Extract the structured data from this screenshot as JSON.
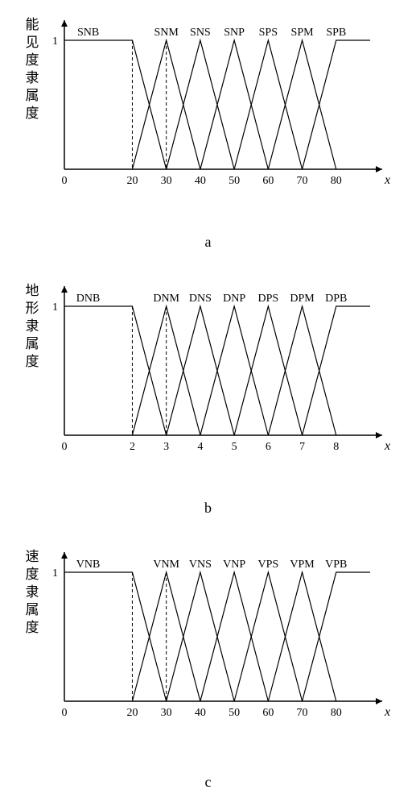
{
  "charts": [
    {
      "id": "a",
      "y_label": "能见度隶属度",
      "sublabel": "a",
      "x_ticks": [
        0,
        20,
        30,
        40,
        50,
        60,
        70,
        80
      ],
      "x_var": "x",
      "y_tick": "1",
      "fuzzy_sets": [
        "SNB",
        "SNM",
        "SNS",
        "SNP",
        "SPS",
        "SPM",
        "SPB"
      ],
      "x_range": [
        0,
        90
      ]
    },
    {
      "id": "b",
      "y_label": "地形隶属度",
      "sublabel": "b",
      "x_ticks": [
        0,
        2,
        3,
        4,
        5,
        6,
        7,
        8
      ],
      "x_var": "x",
      "y_tick": "1",
      "fuzzy_sets": [
        "DNB",
        "DNM",
        "DNS",
        "DNP",
        "DPS",
        "DPM",
        "DPB"
      ],
      "x_range": [
        0,
        9
      ]
    },
    {
      "id": "c",
      "y_label": "速度隶属度",
      "sublabel": "c",
      "x_ticks": [
        0,
        20,
        30,
        40,
        50,
        60,
        70,
        80
      ],
      "x_var": "x",
      "y_tick": "1",
      "fuzzy_sets": [
        "VNB",
        "VNM",
        "VNS",
        "VNP",
        "VPS",
        "VPM",
        "VPB"
      ],
      "x_range": [
        0,
        90
      ]
    }
  ],
  "chart_data": [
    {
      "type": "line",
      "title": "能见度隶属度 (Visibility Membership)",
      "xlabel": "x",
      "ylabel": "能见度隶属度",
      "xlim": [
        0,
        90
      ],
      "ylim": [
        0,
        1
      ],
      "series": [
        {
          "name": "SNB",
          "x": [
            0,
            20,
            30
          ],
          "y": [
            1,
            1,
            0
          ]
        },
        {
          "name": "SNM",
          "x": [
            20,
            30,
            40
          ],
          "y": [
            0,
            1,
            0
          ]
        },
        {
          "name": "SNS",
          "x": [
            30,
            40,
            50
          ],
          "y": [
            0,
            1,
            0
          ]
        },
        {
          "name": "SNP",
          "x": [
            40,
            50,
            60
          ],
          "y": [
            0,
            1,
            0
          ]
        },
        {
          "name": "SPS",
          "x": [
            50,
            60,
            70
          ],
          "y": [
            0,
            1,
            0
          ]
        },
        {
          "name": "SPM",
          "x": [
            60,
            70,
            80
          ],
          "y": [
            0,
            1,
            0
          ]
        },
        {
          "name": "SPB",
          "x": [
            70,
            80,
            90
          ],
          "y": [
            0,
            1,
            1
          ]
        }
      ]
    },
    {
      "type": "line",
      "title": "地形隶属度 (Terrain Membership)",
      "xlabel": "x",
      "ylabel": "地形隶属度",
      "xlim": [
        0,
        9
      ],
      "ylim": [
        0,
        1
      ],
      "series": [
        {
          "name": "DNB",
          "x": [
            0,
            2,
            3
          ],
          "y": [
            1,
            1,
            0
          ]
        },
        {
          "name": "DNM",
          "x": [
            2,
            3,
            4
          ],
          "y": [
            0,
            1,
            0
          ]
        },
        {
          "name": "DNS",
          "x": [
            3,
            4,
            5
          ],
          "y": [
            0,
            1,
            0
          ]
        },
        {
          "name": "DNP",
          "x": [
            4,
            5,
            6
          ],
          "y": [
            0,
            1,
            0
          ]
        },
        {
          "name": "DPS",
          "x": [
            5,
            6,
            7
          ],
          "y": [
            0,
            1,
            0
          ]
        },
        {
          "name": "DPM",
          "x": [
            6,
            7,
            8
          ],
          "y": [
            0,
            1,
            0
          ]
        },
        {
          "name": "DPB",
          "x": [
            7,
            8,
            9
          ],
          "y": [
            0,
            1,
            1
          ]
        }
      ]
    },
    {
      "type": "line",
      "title": "速度隶属度 (Velocity Membership)",
      "xlabel": "x",
      "ylabel": "速度隶属度",
      "xlim": [
        0,
        90
      ],
      "ylim": [
        0,
        1
      ],
      "series": [
        {
          "name": "VNB",
          "x": [
            0,
            20,
            30
          ],
          "y": [
            1,
            1,
            0
          ]
        },
        {
          "name": "VNM",
          "x": [
            20,
            30,
            40
          ],
          "y": [
            0,
            1,
            0
          ]
        },
        {
          "name": "VNS",
          "x": [
            30,
            40,
            50
          ],
          "y": [
            0,
            1,
            0
          ]
        },
        {
          "name": "VNP",
          "x": [
            40,
            50,
            60
          ],
          "y": [
            0,
            1,
            0
          ]
        },
        {
          "name": "VPS",
          "x": [
            50,
            60,
            70
          ],
          "y": [
            0,
            1,
            0
          ]
        },
        {
          "name": "VPM",
          "x": [
            60,
            70,
            80
          ],
          "y": [
            0,
            1,
            0
          ]
        },
        {
          "name": "VPB",
          "x": [
            70,
            80,
            90
          ],
          "y": [
            0,
            1,
            1
          ]
        }
      ]
    }
  ]
}
